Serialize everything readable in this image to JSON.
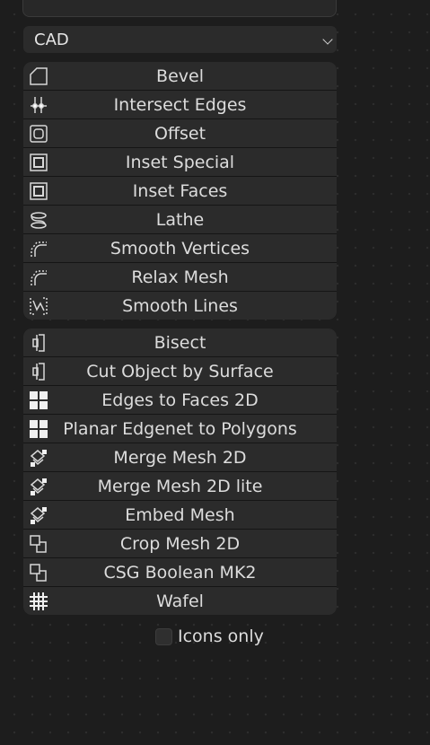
{
  "dropdown": {
    "value": "CAD"
  },
  "group1": [
    {
      "label": "Bevel",
      "icon": "bevel-icon"
    },
    {
      "label": "Intersect Edges",
      "icon": "intersect-edges-icon"
    },
    {
      "label": "Offset",
      "icon": "offset-icon"
    },
    {
      "label": "Inset Special",
      "icon": "inset-special-icon"
    },
    {
      "label": "Inset Faces",
      "icon": "inset-faces-icon"
    },
    {
      "label": "Lathe",
      "icon": "lathe-icon"
    },
    {
      "label": "Smooth Vertices",
      "icon": "smooth-vertices-icon"
    },
    {
      "label": "Relax Mesh",
      "icon": "relax-mesh-icon"
    },
    {
      "label": "Smooth Lines",
      "icon": "smooth-lines-icon"
    }
  ],
  "group2": [
    {
      "label": "Bisect",
      "icon": "bisect-icon"
    },
    {
      "label": "Cut Object by Surface",
      "icon": "cut-object-icon"
    },
    {
      "label": "Edges to Faces 2D",
      "icon": "edges-to-faces-icon"
    },
    {
      "label": "Planar Edgenet to Polygons",
      "icon": "planar-edgenet-icon"
    },
    {
      "label": "Merge Mesh 2D",
      "icon": "merge-mesh-icon"
    },
    {
      "label": "Merge Mesh 2D lite",
      "icon": "merge-mesh-lite-icon"
    },
    {
      "label": "Embed Mesh",
      "icon": "embed-mesh-icon"
    },
    {
      "label": "Crop Mesh 2D",
      "icon": "crop-mesh-icon"
    },
    {
      "label": "CSG Boolean MK2",
      "icon": "csg-boolean-icon"
    },
    {
      "label": "Wafel",
      "icon": "wafel-icon"
    }
  ],
  "toggle": {
    "label": "Icons only",
    "checked": false
  }
}
